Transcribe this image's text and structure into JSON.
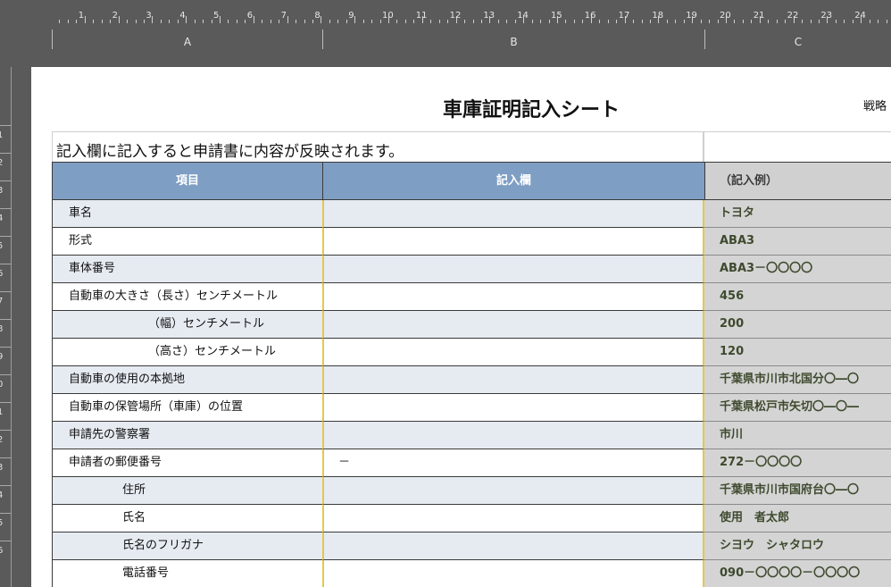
{
  "ruler_top": {
    "numbers": [
      "1",
      "2",
      "3",
      "4",
      "5",
      "6",
      "7",
      "8",
      "9",
      "10",
      "11",
      "12",
      "13",
      "14",
      "15",
      "16",
      "17",
      "18",
      "19",
      "20",
      "21",
      "22",
      "23",
      "24"
    ]
  },
  "columns": [
    "A",
    "B",
    "C"
  ],
  "ruler_left": {
    "numbers": [
      "1",
      "2",
      "3",
      "4",
      "5",
      "6",
      "7",
      "8",
      "9",
      "0",
      "1",
      "2",
      "3",
      "4",
      "5",
      "6"
    ]
  },
  "sheet": {
    "title": "車庫証明記入シート",
    "title_right": "戦略",
    "notice": "記入欄に記入すると申請書に内容が反映されます。",
    "headers": {
      "item": "項目",
      "input": "記入欄",
      "example": "（記入例）"
    },
    "rows": [
      {
        "label": "車名",
        "indent": 18,
        "value": "",
        "example": "トヨタ"
      },
      {
        "label": "形式",
        "indent": 18,
        "value": "",
        "example": "ABA3"
      },
      {
        "label": "車体番号",
        "indent": 18,
        "value": "",
        "example": "ABA3－〇〇〇〇"
      },
      {
        "label": "自動車の大きさ（長さ）センチメートル",
        "indent": 18,
        "value": "",
        "example": "456"
      },
      {
        "label": "（幅）センチメートル",
        "indent": 107,
        "value": "",
        "example": "200"
      },
      {
        "label": "（高さ）センチメートル",
        "indent": 107,
        "value": "",
        "example": "120"
      },
      {
        "label": "自動車の使用の本拠地",
        "indent": 18,
        "value": "",
        "example": "千葉県市川市北国分〇―〇"
      },
      {
        "label": "自動車の保管場所（車庫）の位置",
        "indent": 18,
        "value": "",
        "example": "千葉県松戸市矢切〇―〇―"
      },
      {
        "label": "申請先の警察署",
        "indent": 18,
        "value": "",
        "example": "市川"
      },
      {
        "label": "申請者の郵便番号",
        "indent": 18,
        "value": "－",
        "example": "272－〇〇〇〇"
      },
      {
        "label": "住所",
        "indent": 78,
        "value": "",
        "example": "千葉県市川市国府台〇―〇"
      },
      {
        "label": "氏名",
        "indent": 78,
        "value": "",
        "example": "使用　者太郎"
      },
      {
        "label": "氏名のフリガナ",
        "indent": 78,
        "value": "",
        "example": "シヨウ　シャタロウ"
      },
      {
        "label": "電話番号",
        "indent": 78,
        "value": "",
        "example": "090－〇〇〇〇－〇〇〇〇"
      }
    ]
  }
}
